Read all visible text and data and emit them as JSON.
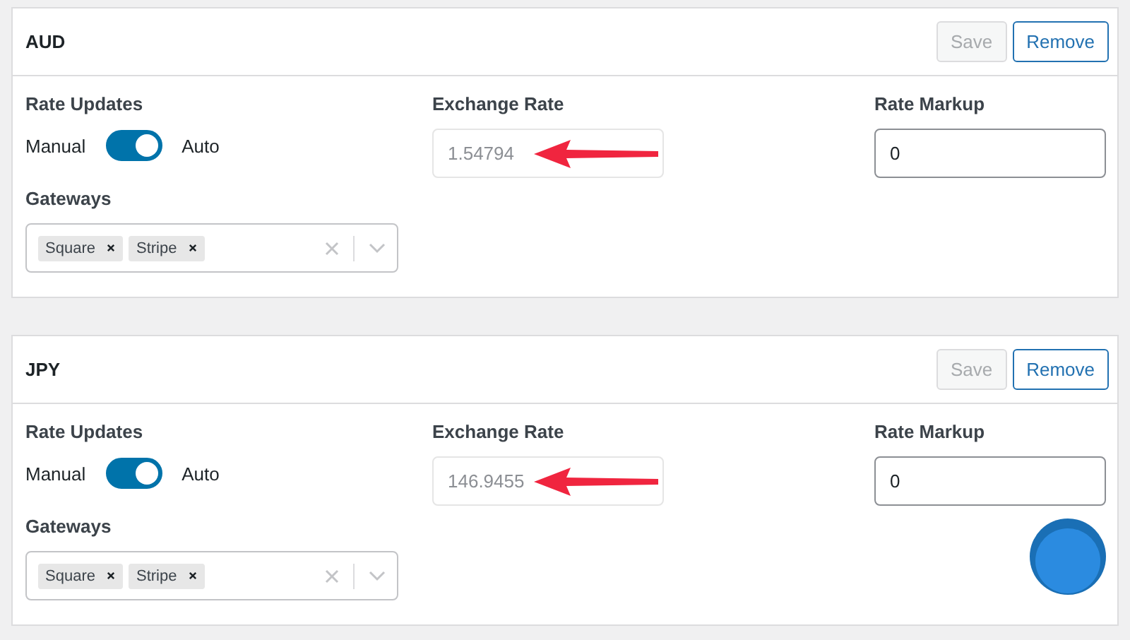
{
  "currencies": [
    {
      "code": "AUD",
      "buttons": [
        {
          "label": "Save",
          "disabled": true
        },
        {
          "label": "Remove",
          "disabled": false
        }
      ],
      "rate_updates": {
        "label": "Rate Updates",
        "off_label": "Manual",
        "on_label": "Auto",
        "on": true
      },
      "exchange_rate": {
        "label": "Exchange Rate",
        "value": "1.54794",
        "disabled": true,
        "arrow": true
      },
      "rate_markup": {
        "label": "Rate Markup",
        "value": "0"
      },
      "gateways": {
        "label": "Gateways",
        "tags": [
          "Square",
          "Stripe"
        ]
      }
    },
    {
      "code": "JPY",
      "buttons": [
        {
          "label": "Save",
          "disabled": true
        },
        {
          "label": "Remove",
          "disabled": false
        }
      ],
      "rate_updates": {
        "label": "Rate Updates",
        "off_label": "Manual",
        "on_label": "Auto",
        "on": true
      },
      "exchange_rate": {
        "label": "Exchange Rate",
        "value": "146.9455",
        "disabled": true,
        "arrow": true
      },
      "rate_markup": {
        "label": "Rate Markup",
        "value": "0"
      },
      "gateways": {
        "label": "Gateways",
        "tags": [
          "Square",
          "Stripe"
        ]
      }
    }
  ]
}
